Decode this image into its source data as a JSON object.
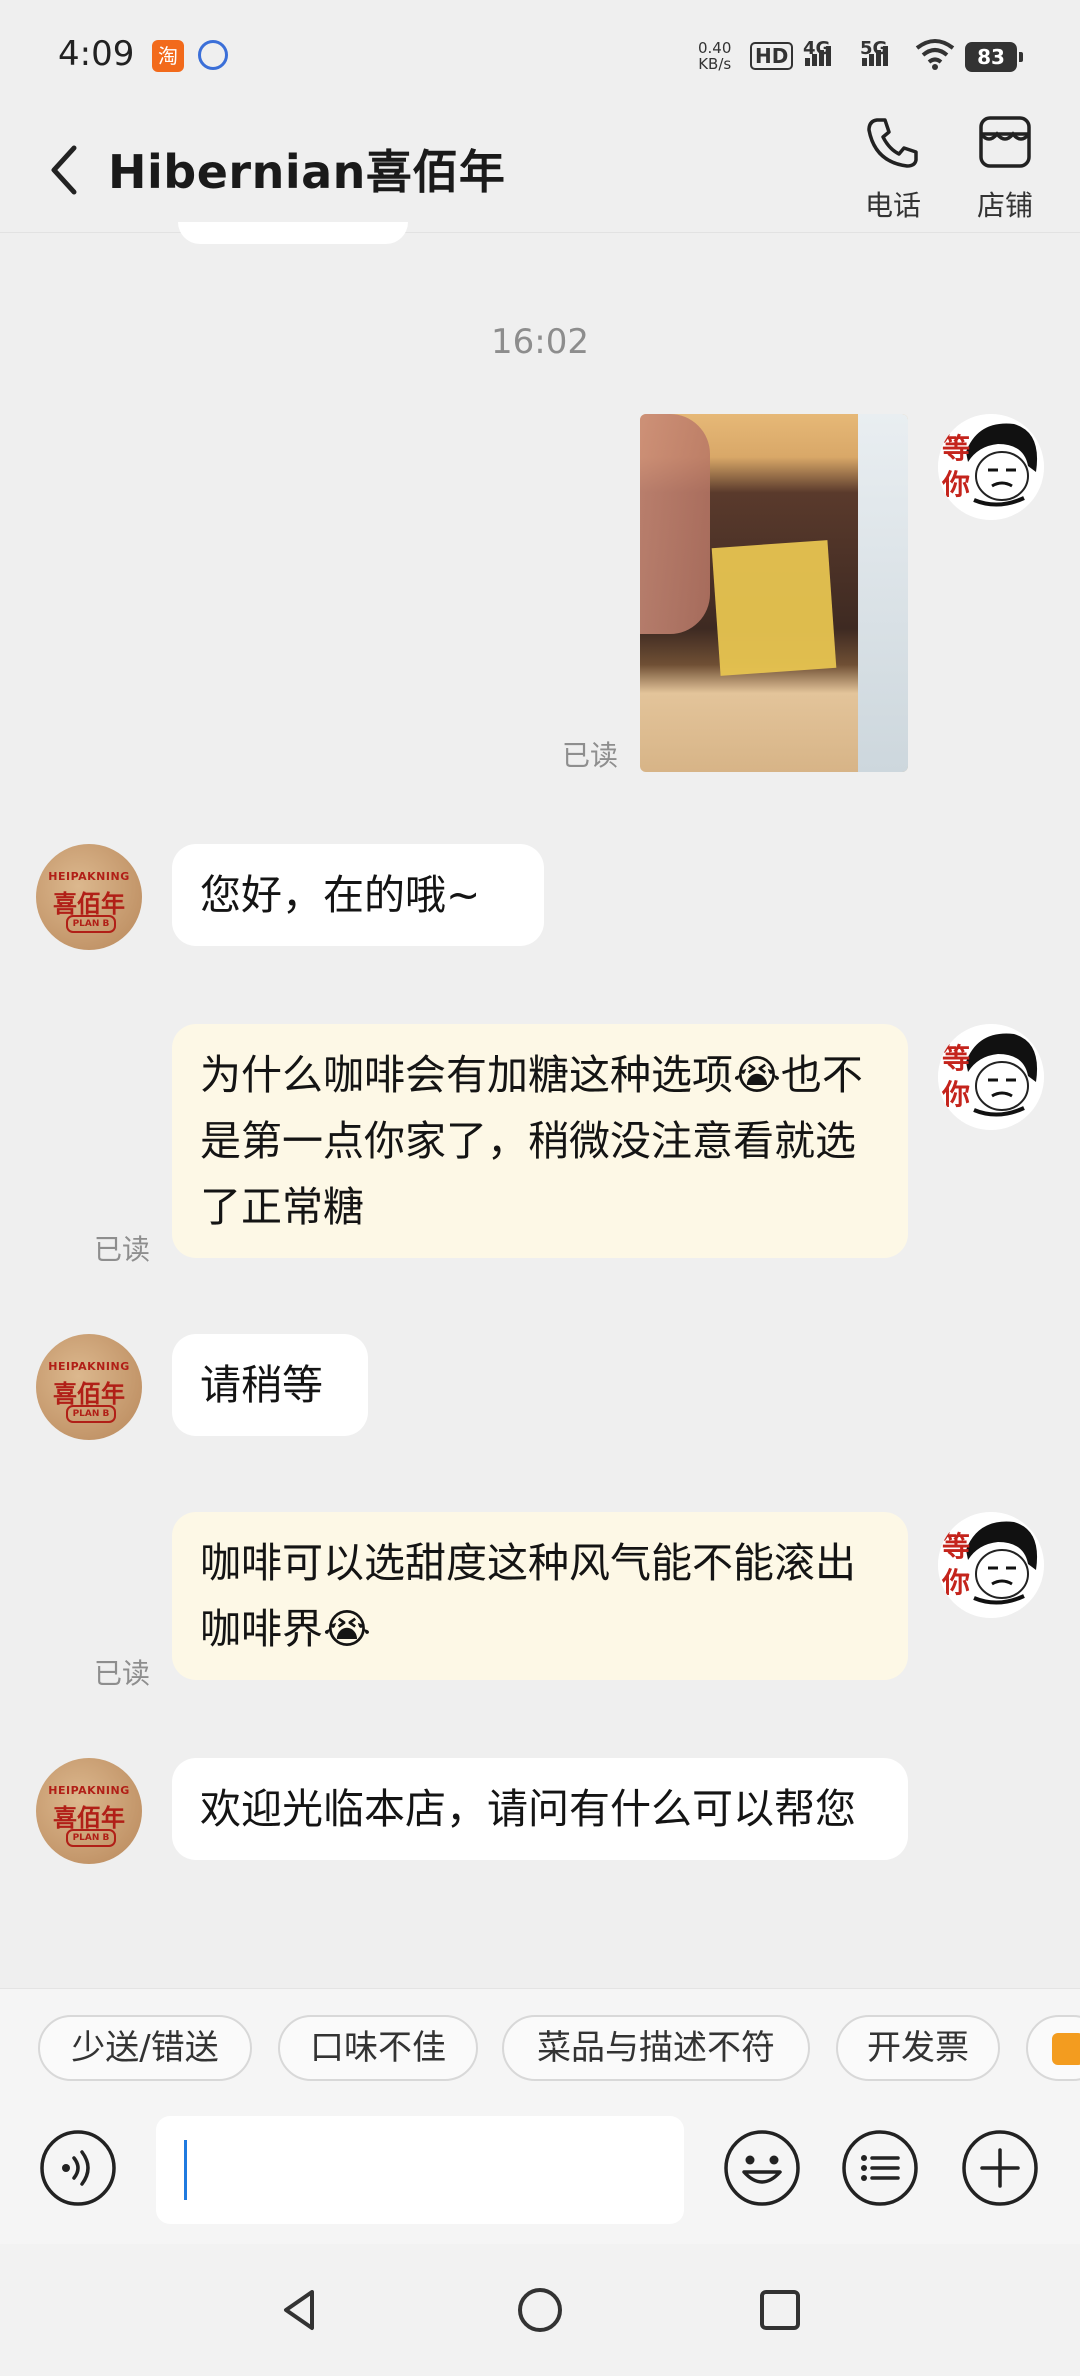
{
  "status_bar": {
    "time": "4:09",
    "app_icons": [
      "taobao-icon",
      "baidu-icon"
    ],
    "net_speed": "0.40",
    "net_speed_unit": "KB/s",
    "hd_label": "HD",
    "net_4g": "4G",
    "net_5g": "5G",
    "battery": "83"
  },
  "header": {
    "title": "Hibernian喜佰年",
    "phone_label": "电话",
    "shop_label": "店铺"
  },
  "chat": {
    "timestamp": "16:02",
    "messages": [
      {
        "side": "right",
        "type": "image",
        "status": "已读"
      },
      {
        "side": "left",
        "text": "您好，在的哦~"
      },
      {
        "side": "right",
        "text": "为什么咖啡会有加糖这种选项😭也不是第一点你家了，稍微没注意看就选了正常糖",
        "status": "已读"
      },
      {
        "side": "left",
        "text": "请稍等"
      },
      {
        "side": "right",
        "text": "咖啡可以选甜度这种风气能不能滚出咖啡界😭",
        "status": "已读"
      },
      {
        "side": "left",
        "text": "欢迎光临本店，请问有什么可以帮您"
      }
    ]
  },
  "shop_avatar": {
    "top_text": "HEIPAKNING",
    "mid_text": "喜佰年",
    "bottom_text": "PLAN B"
  },
  "user_avatar": {
    "text": "等你"
  },
  "quick_replies": [
    "少送/错送",
    "口味不佳",
    "菜品与描述不符",
    "开发票"
  ],
  "colors": {
    "background": "#efefef",
    "bubble_left": "#ffffff",
    "bubble_right": "#fdf8e6",
    "accent": "#b11f17",
    "caret": "#1f7ae0"
  }
}
